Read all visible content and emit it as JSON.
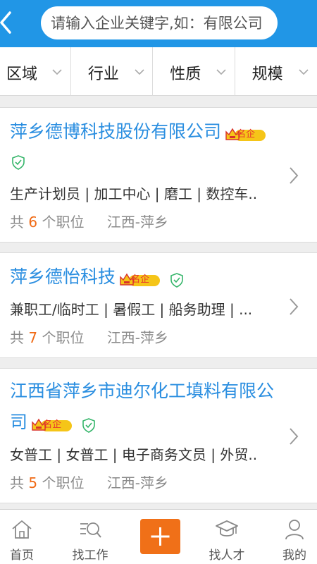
{
  "header": {
    "search_placeholder": "请输入企业关键字,如：有限公司"
  },
  "filters": [
    {
      "label": "区域"
    },
    {
      "label": "行业"
    },
    {
      "label": "性质"
    },
    {
      "label": "规模"
    }
  ],
  "companies": [
    {
      "name": "萍乡德博科技股份有限公司",
      "badge": "名企",
      "jobs": "生产计划员 | 加工中心 | 磨工 | 数控车..",
      "count_prefix": "共",
      "count": "6",
      "count_suffix": "个职位",
      "location": "江西-萍乡"
    },
    {
      "name": "萍乡德怡科技",
      "badge": "名企",
      "jobs": "兼职工/临时工 | 暑假工 | 船务助理 | ...",
      "count_prefix": "共",
      "count": "7",
      "count_suffix": "个职位",
      "location": "江西-萍乡"
    },
    {
      "name_line1": "江西省萍乡市迪尔化工填料有限公",
      "name_line2": "司",
      "badge": "名企",
      "jobs": "女普工 | 女普工 | 电子商务文员 | 外贸..",
      "count_prefix": "共",
      "count": "5",
      "count_suffix": "个职位",
      "location": "江西-萍乡"
    }
  ],
  "tabbar": {
    "home": "首页",
    "find_job": "找工作",
    "find_talent": "找人才",
    "mine": "我的"
  },
  "colors": {
    "primary": "#2196e6",
    "link": "#2a8ee0",
    "accent": "#f07018",
    "badge": "#f5c518",
    "verified": "#35b56a"
  },
  "icons": [
    "back-icon",
    "search-icon",
    "chevron-down-icon",
    "crown-icon",
    "verified-shield-icon",
    "chevron-right-icon",
    "home-icon",
    "find-job-icon",
    "plus-icon",
    "find-talent-icon",
    "user-icon"
  ]
}
